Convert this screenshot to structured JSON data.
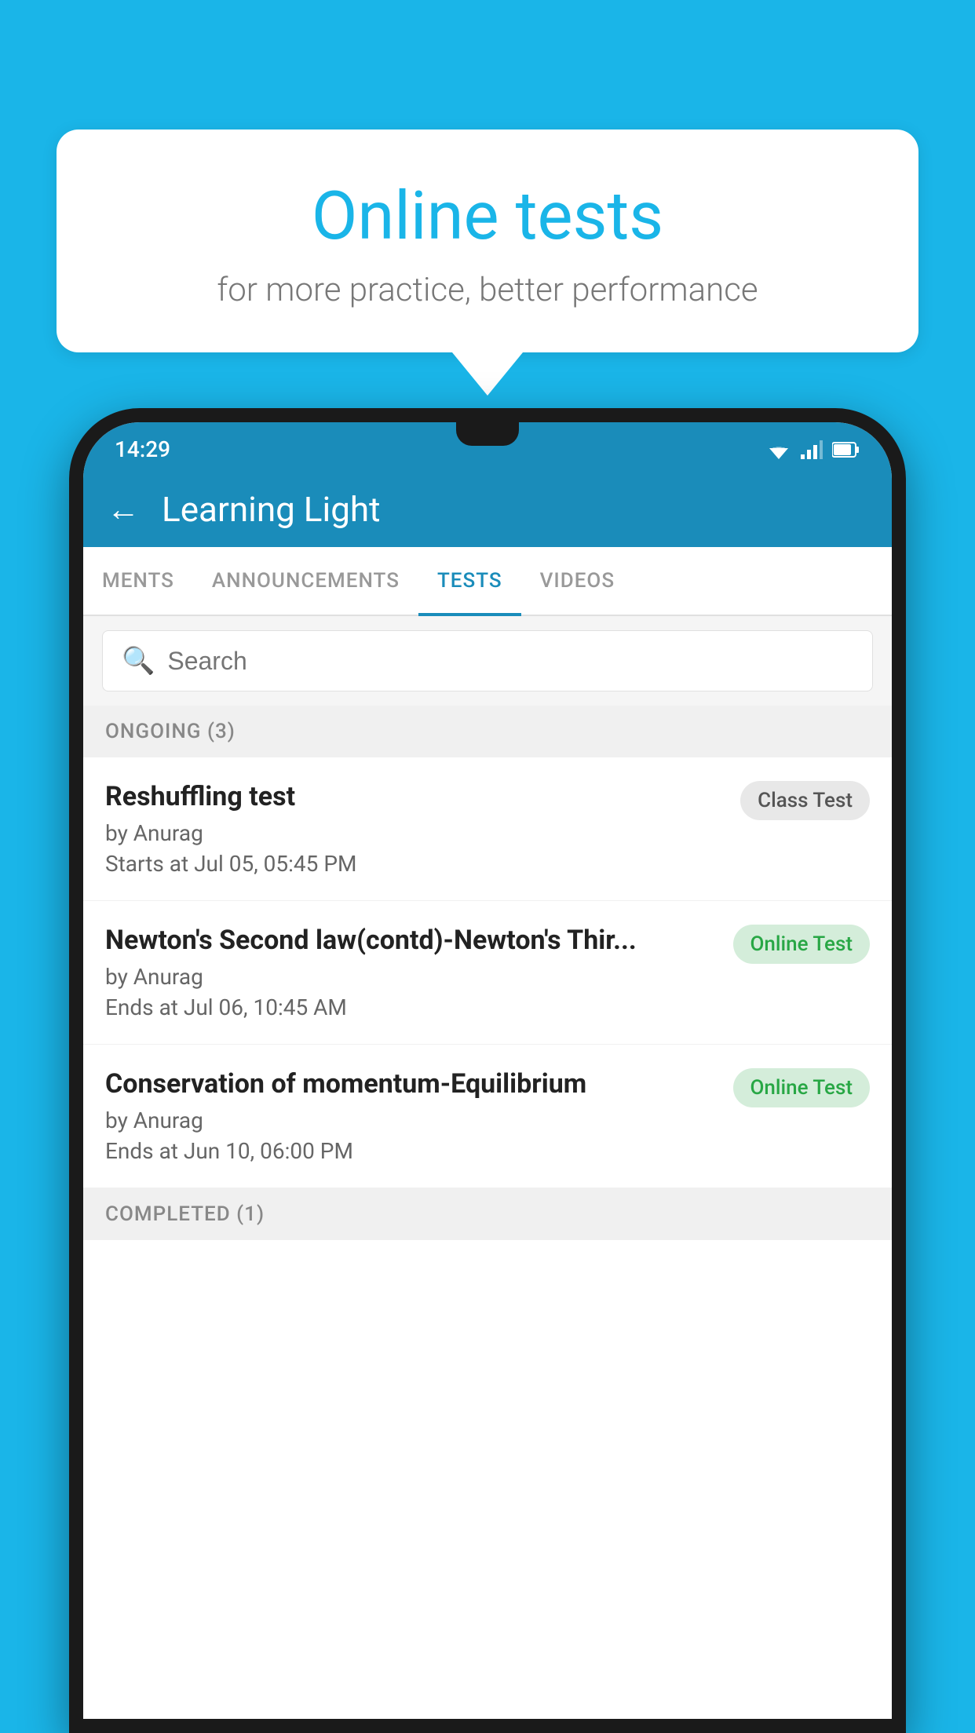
{
  "background_color": "#1ab5e8",
  "speech_bubble": {
    "title": "Online tests",
    "subtitle": "for more practice, better performance"
  },
  "phone": {
    "status_bar": {
      "time": "14:29"
    },
    "app_bar": {
      "title": "Learning Light",
      "back_label": "←"
    },
    "tabs": [
      {
        "label": "MENTS",
        "active": false
      },
      {
        "label": "ANNOUNCEMENTS",
        "active": false
      },
      {
        "label": "TESTS",
        "active": true
      },
      {
        "label": "VIDEOS",
        "active": false
      }
    ],
    "search": {
      "placeholder": "Search"
    },
    "ongoing_section": {
      "label": "ONGOING (3)"
    },
    "tests": [
      {
        "title": "Reshuffling test",
        "author": "by Anurag",
        "date": "Starts at  Jul 05, 05:45 PM",
        "badge": "Class Test",
        "badge_type": "class"
      },
      {
        "title": "Newton's Second law(contd)-Newton's Thir...",
        "author": "by Anurag",
        "date": "Ends at  Jul 06, 10:45 AM",
        "badge": "Online Test",
        "badge_type": "online"
      },
      {
        "title": "Conservation of momentum-Equilibrium",
        "author": "by Anurag",
        "date": "Ends at  Jun 10, 06:00 PM",
        "badge": "Online Test",
        "badge_type": "online"
      }
    ],
    "completed_section": {
      "label": "COMPLETED (1)"
    }
  }
}
